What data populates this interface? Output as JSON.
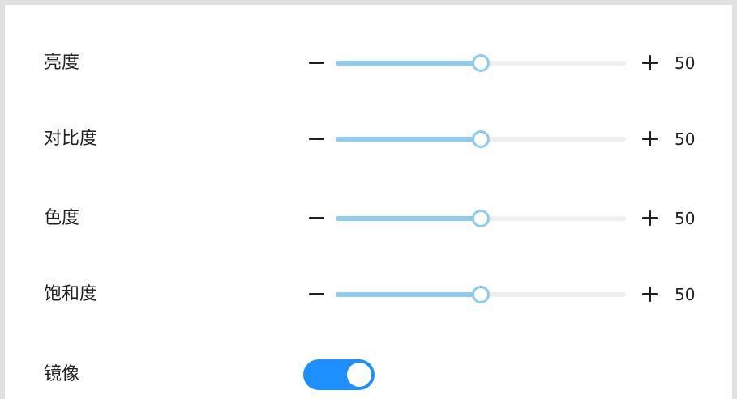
{
  "colors": {
    "slider_fill": "#8cccf3",
    "slider_track": "#efefef",
    "toggle_on": "#1e8fff",
    "frame_border": "#e1e1e1"
  },
  "icons": {
    "decrease": "minus-icon",
    "increase": "plus-icon"
  },
  "settings": {
    "sliders": [
      {
        "label": "亮度",
        "value": "50",
        "level": 0.5
      },
      {
        "label": "对比度",
        "value": "50",
        "level": 0.5
      },
      {
        "label": "色度",
        "value": "50",
        "level": 0.5
      },
      {
        "label": "饱和度",
        "value": "50",
        "level": 0.5
      }
    ],
    "mirror": {
      "label": "镜像",
      "enabled": true
    }
  }
}
